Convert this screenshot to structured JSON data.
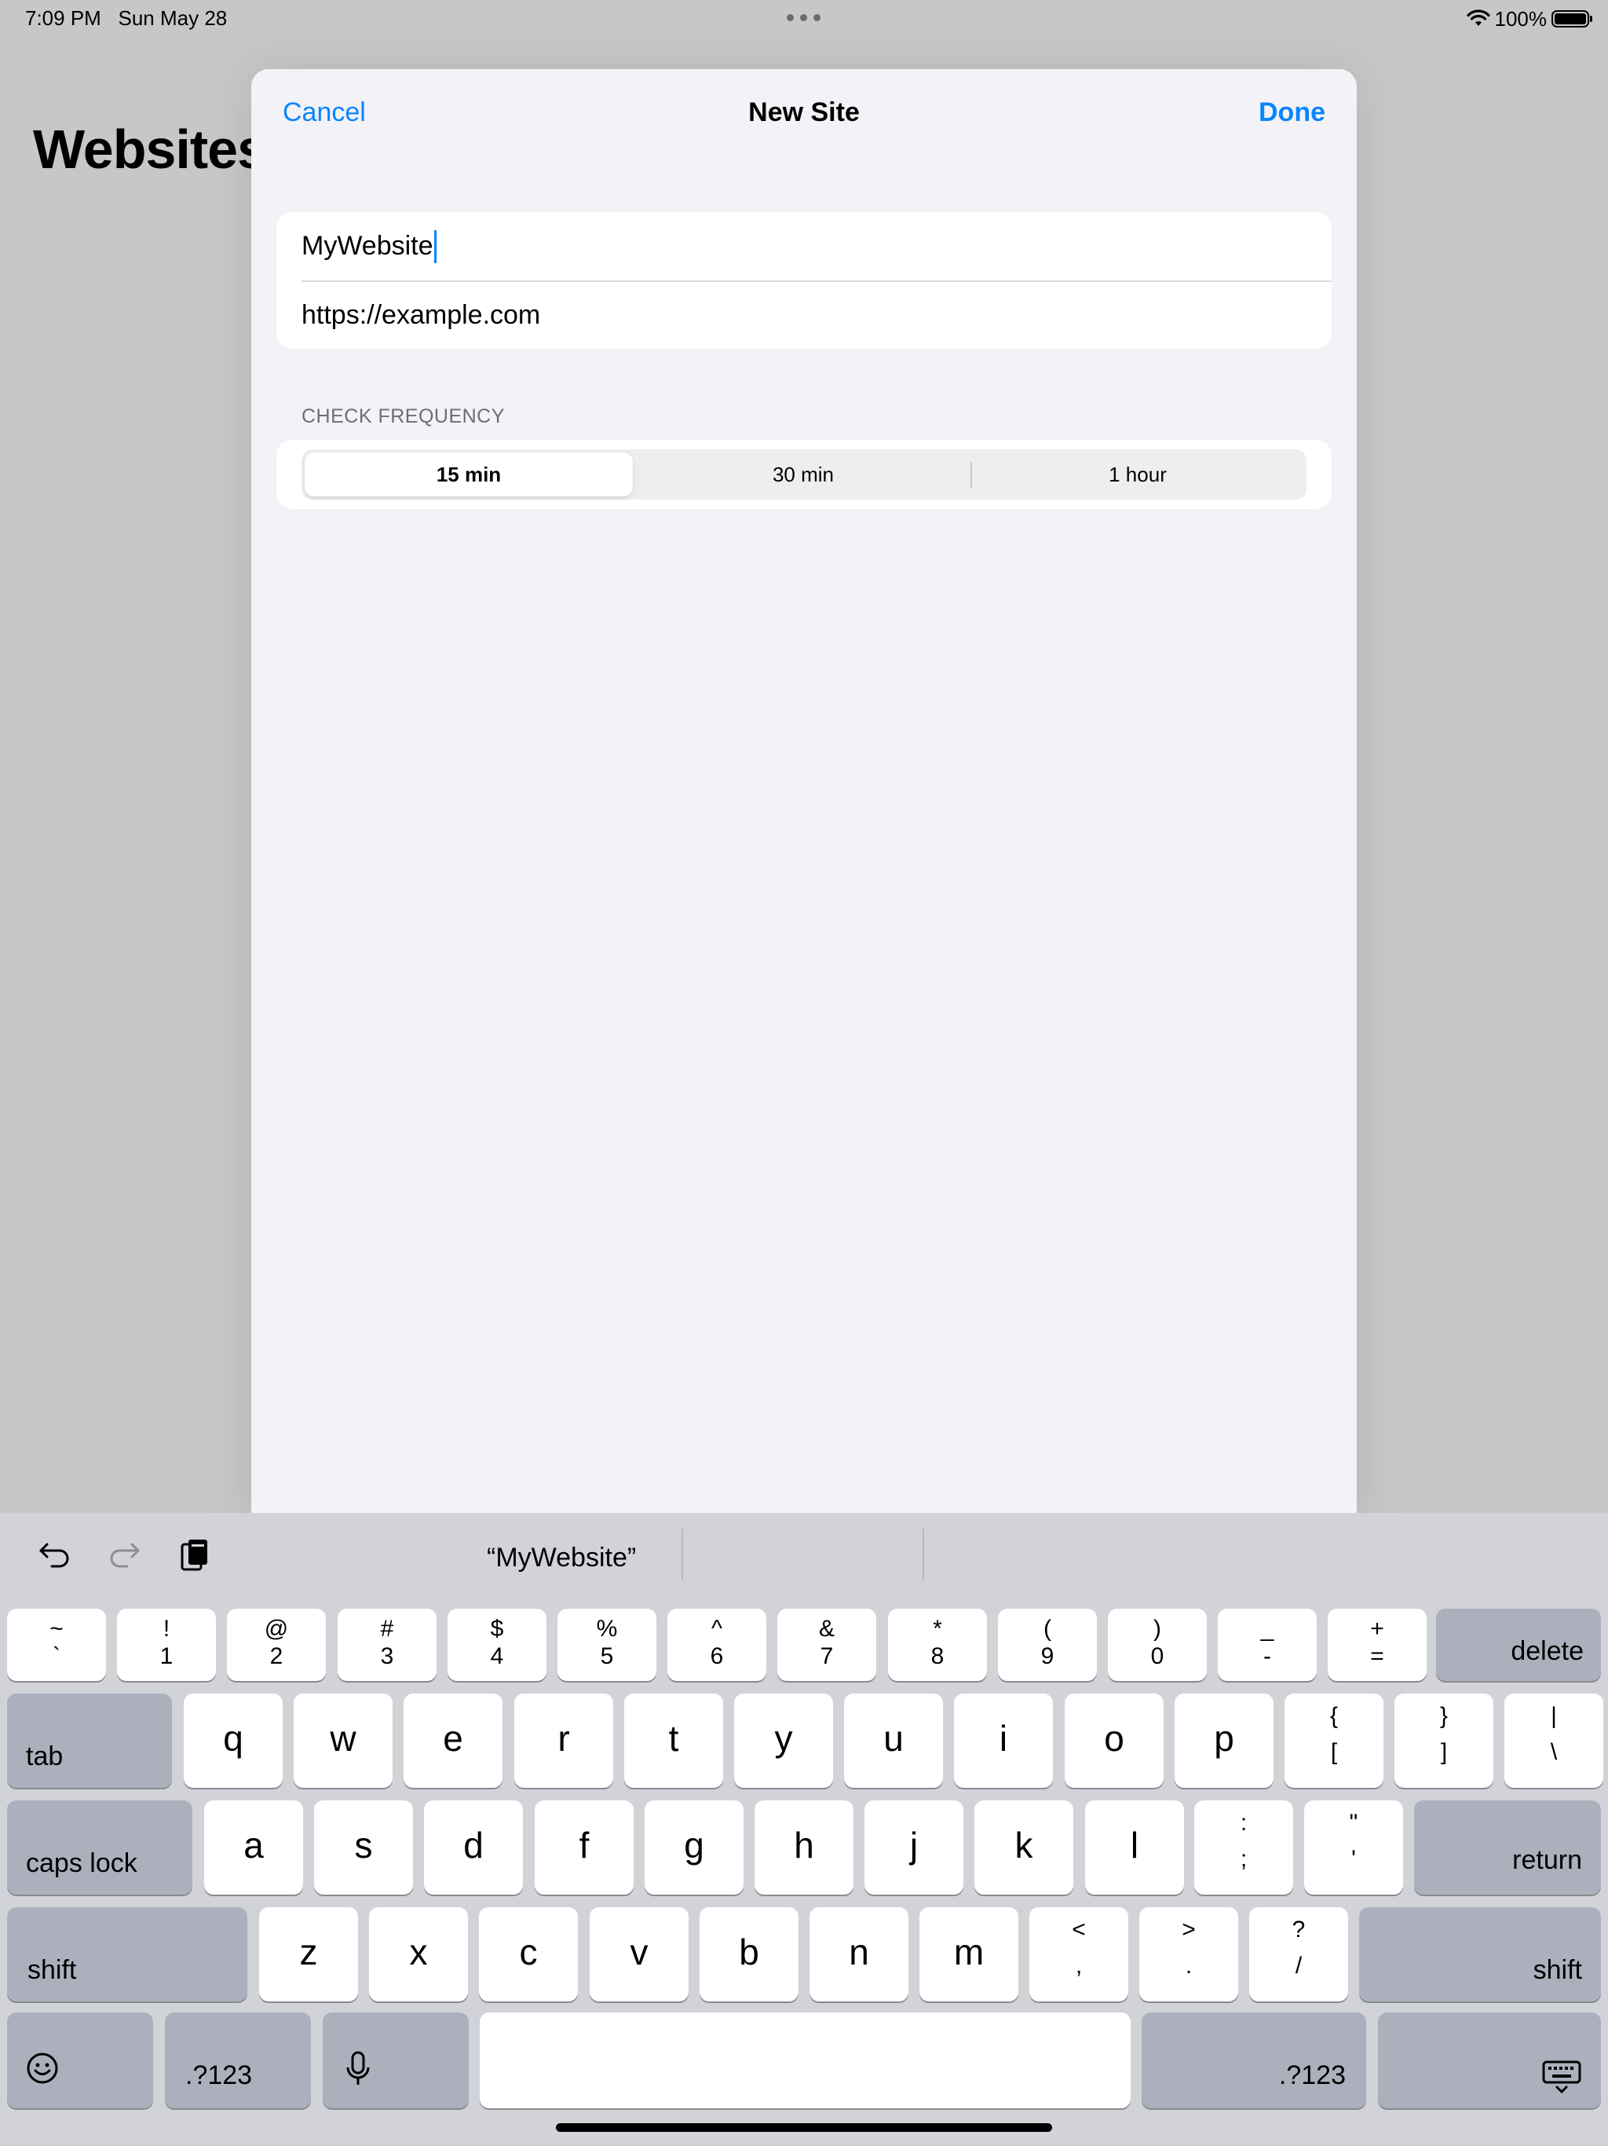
{
  "status_bar": {
    "time": "7:09 PM",
    "date": "Sun May 28",
    "battery": "100%"
  },
  "background": {
    "title": "Websites"
  },
  "sheet": {
    "cancel": "Cancel",
    "title": "New Site",
    "done": "Done",
    "name_value": "MyWebsite",
    "url_value": "https://example.com",
    "section_label": "CHECK FREQUENCY",
    "segments": [
      "15 min",
      "30 min",
      "1 hour"
    ]
  },
  "keyboard": {
    "suggestion": "“MyWebsite”",
    "number_row": [
      {
        "top": "~",
        "bot": "`"
      },
      {
        "top": "!",
        "bot": "1"
      },
      {
        "top": "@",
        "bot": "2"
      },
      {
        "top": "#",
        "bot": "3"
      },
      {
        "top": "$",
        "bot": "4"
      },
      {
        "top": "%",
        "bot": "5"
      },
      {
        "top": "^",
        "bot": "6"
      },
      {
        "top": "&",
        "bot": "7"
      },
      {
        "top": "*",
        "bot": "8"
      },
      {
        "top": "(",
        "bot": "9"
      },
      {
        "top": ")",
        "bot": "0"
      },
      {
        "top": "_",
        "bot": "-"
      },
      {
        "top": "+",
        "bot": "="
      }
    ],
    "delete": "delete",
    "tab": "tab",
    "row_q": [
      "q",
      "w",
      "e",
      "r",
      "t",
      "y",
      "u",
      "i",
      "o",
      "p"
    ],
    "row_q_sym": [
      {
        "top": "{",
        "bot": "["
      },
      {
        "top": "}",
        "bot": "]"
      },
      {
        "top": "|",
        "bot": "\\"
      }
    ],
    "caps_lock": "caps lock",
    "row_a": [
      "a",
      "s",
      "d",
      "f",
      "g",
      "h",
      "j",
      "k",
      "l"
    ],
    "row_a_sym": [
      {
        "top": ":",
        "bot": ";"
      },
      {
        "top": "\"",
        "bot": "'"
      }
    ],
    "return": "return",
    "shift": "shift",
    "row_z": [
      "z",
      "x",
      "c",
      "v",
      "b",
      "n",
      "m"
    ],
    "row_z_sym": [
      {
        "top": "<",
        "bot": ","
      },
      {
        "top": ">",
        "bot": "."
      },
      {
        "top": "?",
        "bot": "/"
      }
    ],
    "numbers_key": ".?123"
  }
}
